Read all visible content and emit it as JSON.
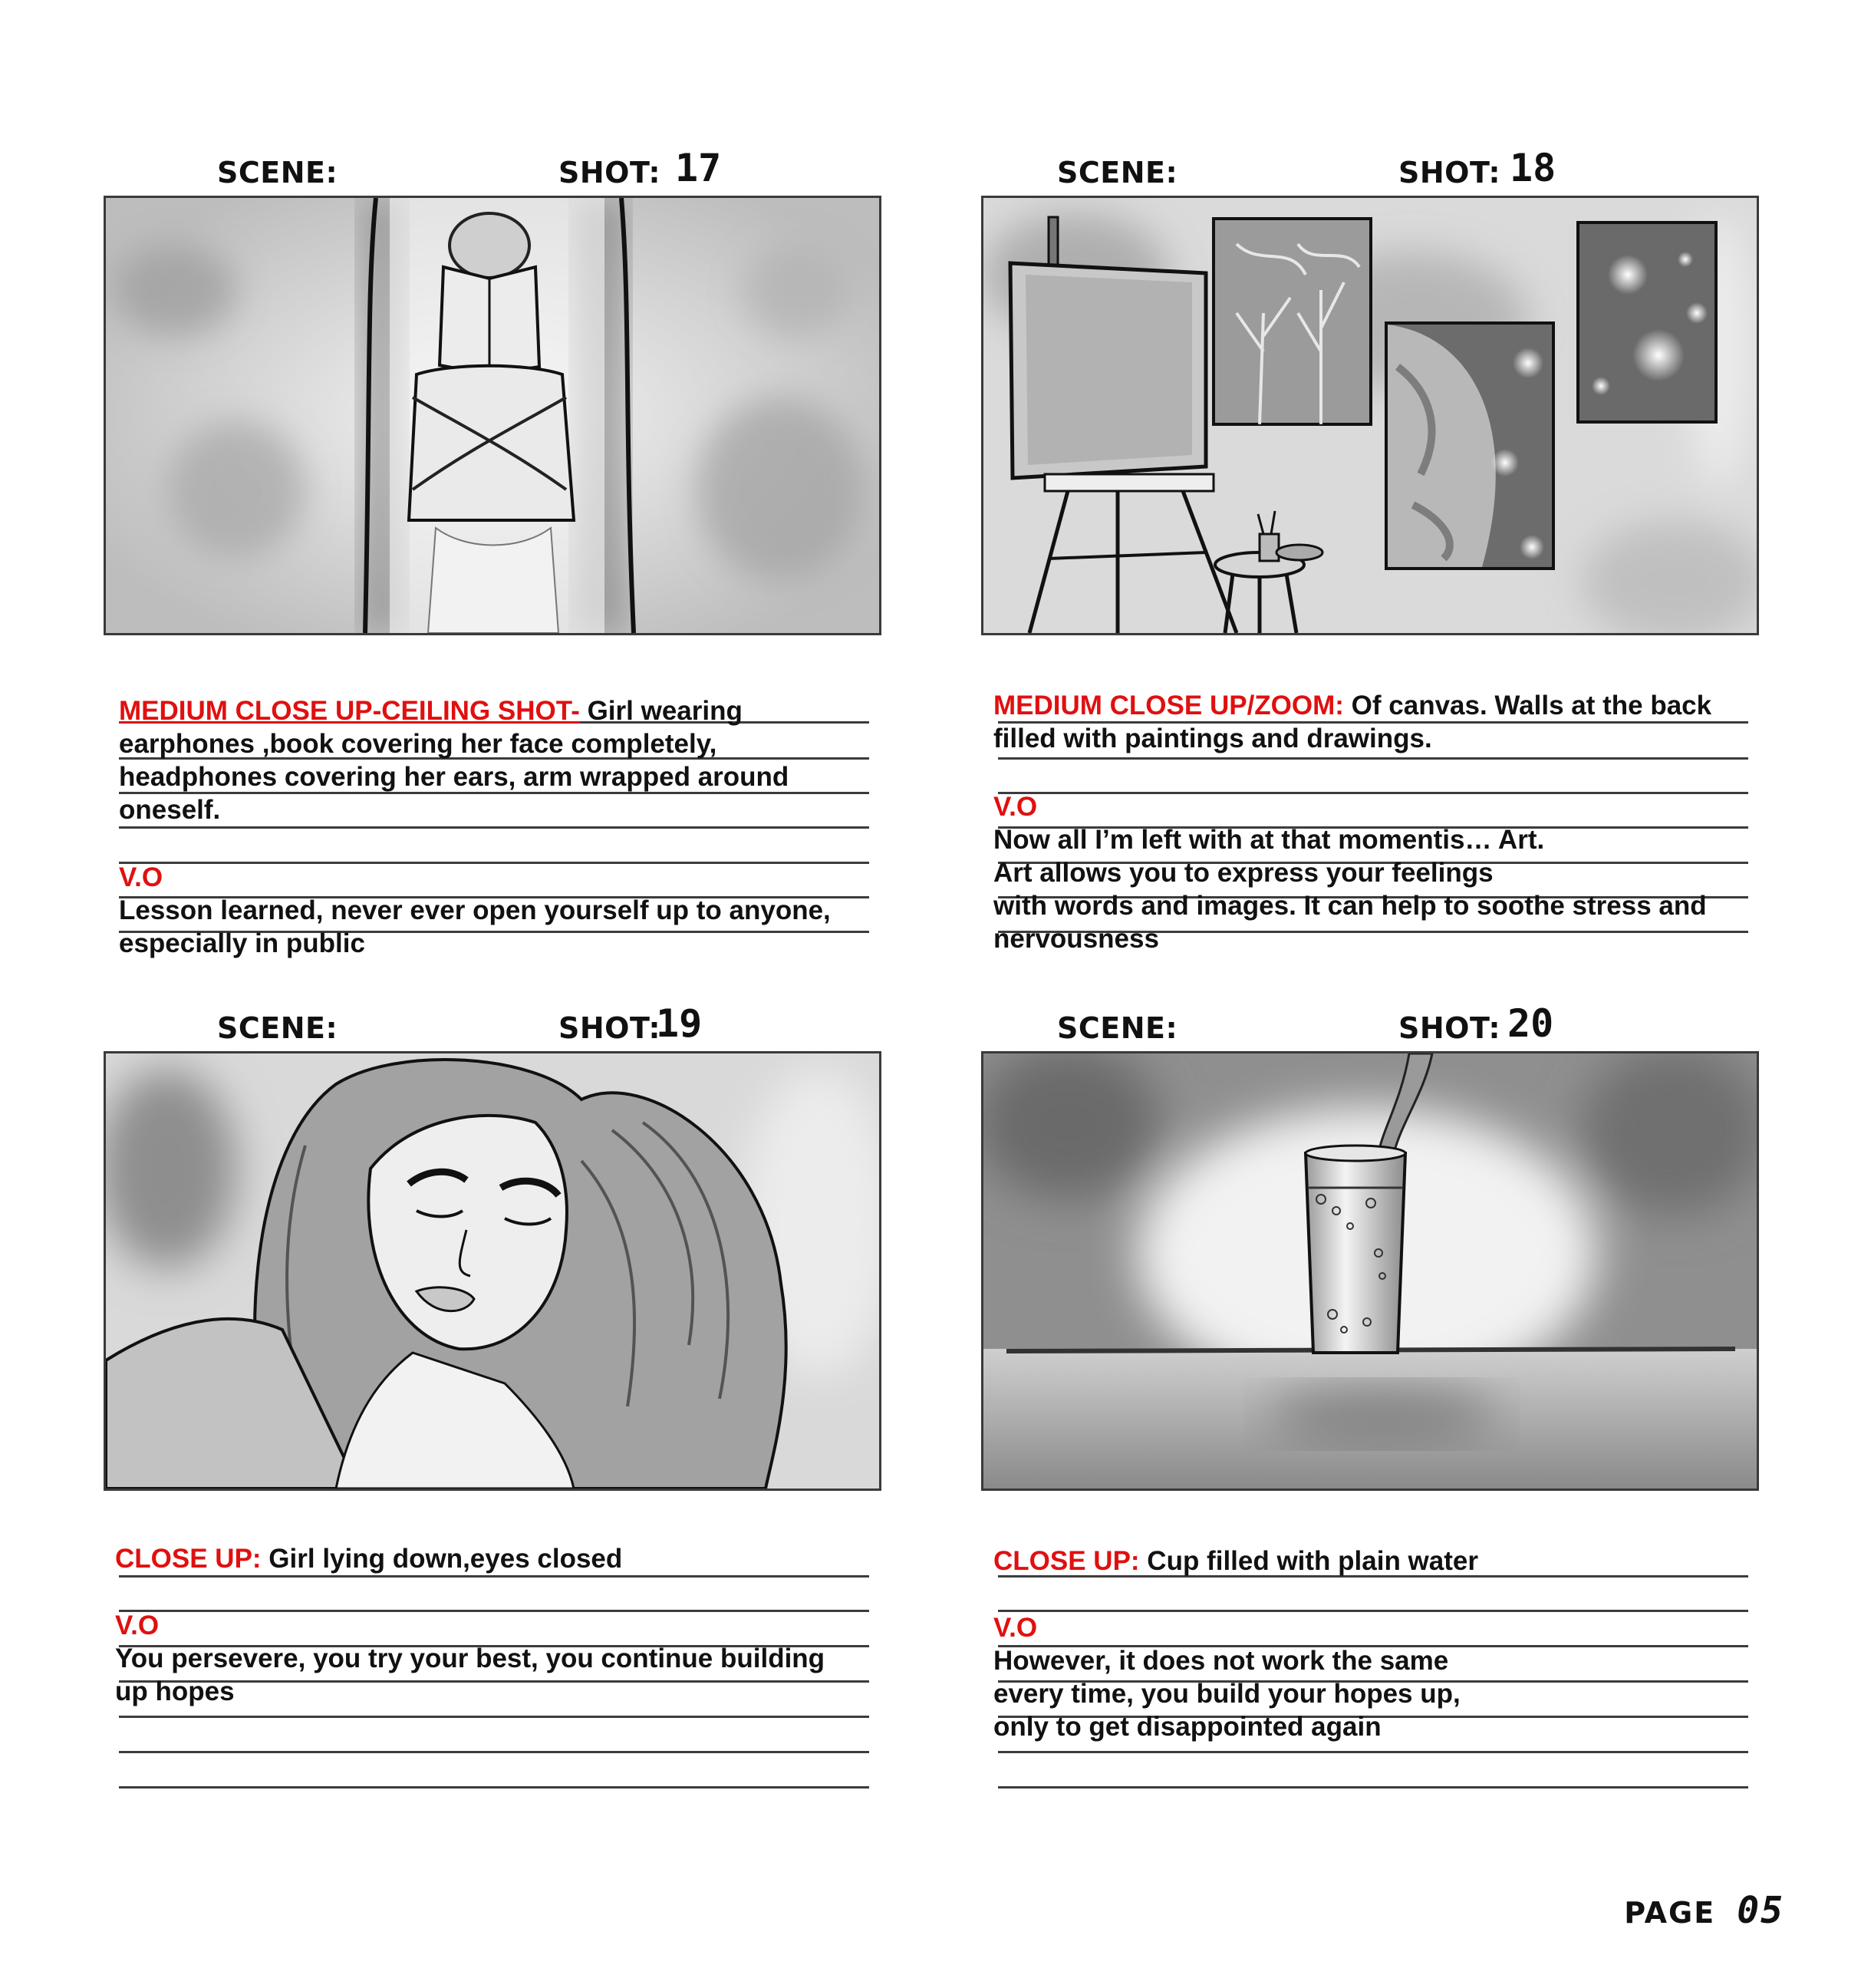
{
  "panels": [
    {
      "scene_label": "SCENE:",
      "shot_label": "SHOT:",
      "shot_number": "17",
      "heading": "MEDIUM CLOSE UP-CEILING SHOT-",
      "heading_rest": " Girl wearing",
      "desc_lines": [
        "earphones ,book covering her face completely,",
        "headphones covering her ears, arm wrapped around",
        "oneself."
      ],
      "vo_label": "V.O",
      "vo_lines": [
        "Lesson learned, never ever open yourself up to anyone,",
        "especially in public"
      ]
    },
    {
      "scene_label": "SCENE:",
      "shot_label": "SHOT:",
      "shot_number": "18",
      "heading": "MEDIUM CLOSE UP/ZOOM:",
      "heading_rest": " Of canvas. Walls at the back",
      "desc_lines": [
        "filled with paintings and drawings."
      ],
      "vo_label": "V.O",
      "vo_lines": [
        "Now all I’m left with at that momentis… Art.",
        "Art allows you to express your feelings",
        "with words and images. It can help to soothe stress and",
        "nervousness"
      ]
    },
    {
      "scene_label": "SCENE:",
      "shot_label": "SHOT:",
      "shot_number": "19",
      "heading": "CLOSE UP:",
      "heading_rest": " Girl lying down,eyes closed",
      "desc_lines": [],
      "vo_label": "V.O",
      "vo_lines": [
        "You persevere, you try your best, you continue building",
        "up hopes"
      ]
    },
    {
      "scene_label": "SCENE:",
      "shot_label": "SHOT:",
      "shot_number": "20",
      "heading": "CLOSE UP:",
      "heading_rest": " Cup filled with plain water",
      "desc_lines": [],
      "vo_label": "V.O",
      "vo_lines": [
        "However, it does not work the same",
        "every time, you build your hopes up,",
        "only to get disappointed again"
      ]
    }
  ],
  "page_label": "PAGE",
  "page_number": "05"
}
